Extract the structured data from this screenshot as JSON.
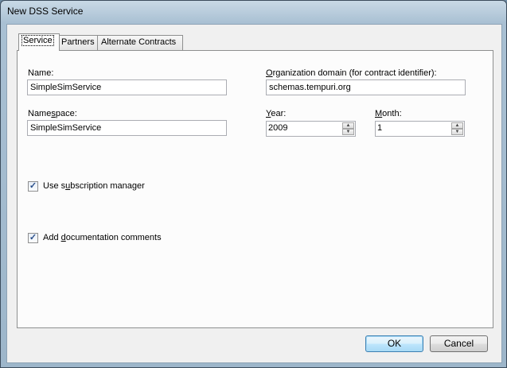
{
  "window": {
    "title": "New DSS Service"
  },
  "tabs": [
    {
      "label": "Service",
      "active": true
    },
    {
      "label": "Partners",
      "active": false
    },
    {
      "label": "Alternate Contracts",
      "active": false
    }
  ],
  "form": {
    "name_label": "Name:",
    "name_value": "SimpleSimService",
    "namespace_label_pre": "Name",
    "namespace_label_u": "s",
    "namespace_label_post": "pace:",
    "namespace_value": "SimpleSimService",
    "org_label_u": "O",
    "org_label_post": "rganization domain (for contract identifier):",
    "org_value": "schemas.tempuri.org",
    "year_label_u": "Y",
    "year_label_post": "ear:",
    "year_value": "2009",
    "month_label_u": "M",
    "month_label_post": "onth:",
    "month_value": "1",
    "use_sub_pre": "Use s",
    "use_sub_u": "u",
    "use_sub_post": "bscription manager",
    "use_sub_checked": true,
    "add_doc_pre": "Add ",
    "add_doc_u": "d",
    "add_doc_post": "ocumentation comments",
    "add_doc_checked": true
  },
  "buttons": {
    "ok": "OK",
    "cancel": "Cancel"
  }
}
